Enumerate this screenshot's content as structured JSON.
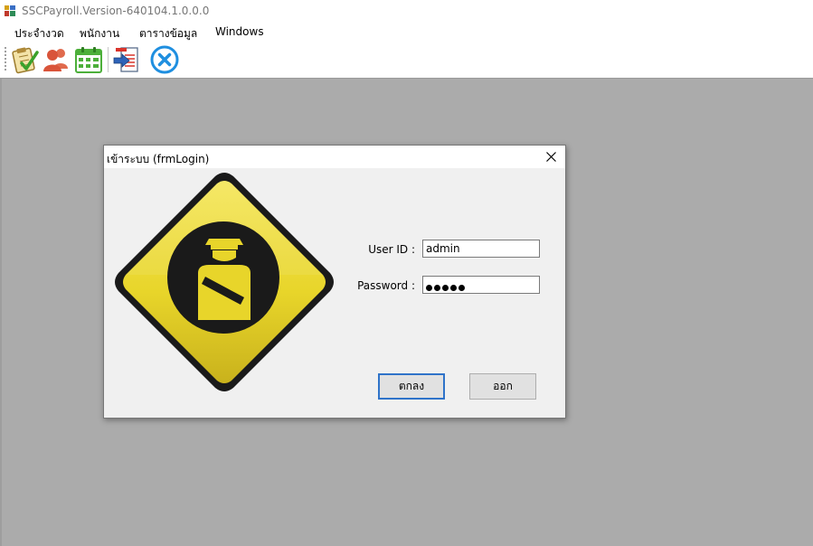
{
  "app": {
    "title": "SSCPayroll.Version-640104.1.0.0.0"
  },
  "menu": [
    {
      "label": "ประจำงวด"
    },
    {
      "label": "พนักงาน"
    },
    {
      "label": "ตารางข้อมูล"
    },
    {
      "label": "Windows"
    }
  ],
  "toolbar": {
    "buttons": [
      {
        "icon": "checklist-icon"
      },
      {
        "icon": "users-icon"
      },
      {
        "icon": "calendar-table-icon"
      },
      {
        "icon": "export-document-icon"
      },
      {
        "icon": "close-circle-icon"
      }
    ]
  },
  "dialog": {
    "title": "เข้าระบบ (frmLogin)",
    "userid_label": "User ID :",
    "userid_value": "admin",
    "password_label": "Password :",
    "password_value": "•••••",
    "ok_label": "ตกลง",
    "exit_label": "ออก"
  },
  "colors": {
    "sign_yellow": "#e8d52a",
    "sign_dark": "#1a1a1a",
    "accent": "#2f73c9",
    "mdi_background": "#ababab"
  }
}
